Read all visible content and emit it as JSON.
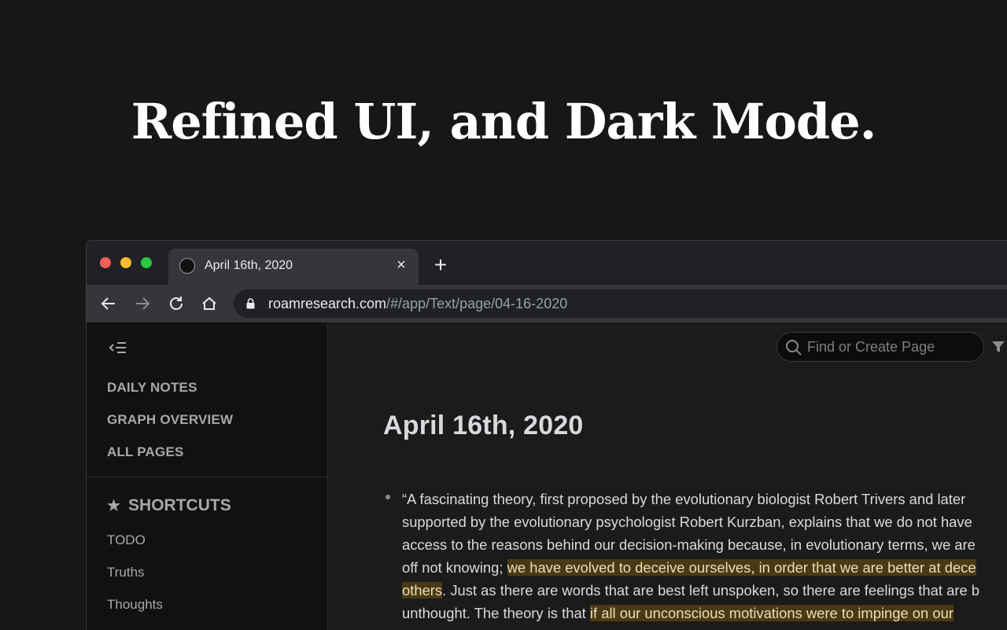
{
  "headline": "Refined UI, and Dark Mode.",
  "browser": {
    "tab_title": "April 16th, 2020",
    "tab_close": "×",
    "new_tab": "+",
    "url_host": "roamresearch.com",
    "url_path": "/#/app/Text/page/04-16-2020"
  },
  "sidebar": {
    "nav": [
      "DAILY NOTES",
      "GRAPH OVERVIEW",
      "ALL PAGES"
    ],
    "shortcuts_title": "SHORTCUTS",
    "shortcuts": [
      "TODO",
      "Truths",
      "Thoughts"
    ]
  },
  "search": {
    "placeholder": "Find or Create Page"
  },
  "page": {
    "title": "April 16th, 2020",
    "lines": [
      [
        {
          "t": "“A fascinating theory, first proposed by the evolutionary biologist Robert Trivers and later",
          "h": false
        }
      ],
      [
        {
          "t": "supported by the evolutionary psychologist Robert Kurzban, explains that we do not have",
          "h": false
        }
      ],
      [
        {
          "t": "access to the reasons behind our decision-making because, in evolutionary terms, we are",
          "h": false
        }
      ],
      [
        {
          "t": "off not knowing; ",
          "h": false
        },
        {
          "t": "we have evolved to deceive ourselves, in order that we are better at dece",
          "h": true
        }
      ],
      [
        {
          "t": "others",
          "h": true
        },
        {
          "t": ". Just as there are words that are best left unspoken, so there are feelings that are b",
          "h": false
        }
      ],
      [
        {
          "t": "unthought. The theory is that ",
          "h": false
        },
        {
          "t": "if all our unconscious motivations were to impinge on our",
          "h": true
        }
      ]
    ]
  },
  "colors": {
    "background": "#171717",
    "highlight": "#4a3a13",
    "traffic_red": "#ff5f57",
    "traffic_yellow": "#febc2e",
    "traffic_green": "#28c840"
  }
}
